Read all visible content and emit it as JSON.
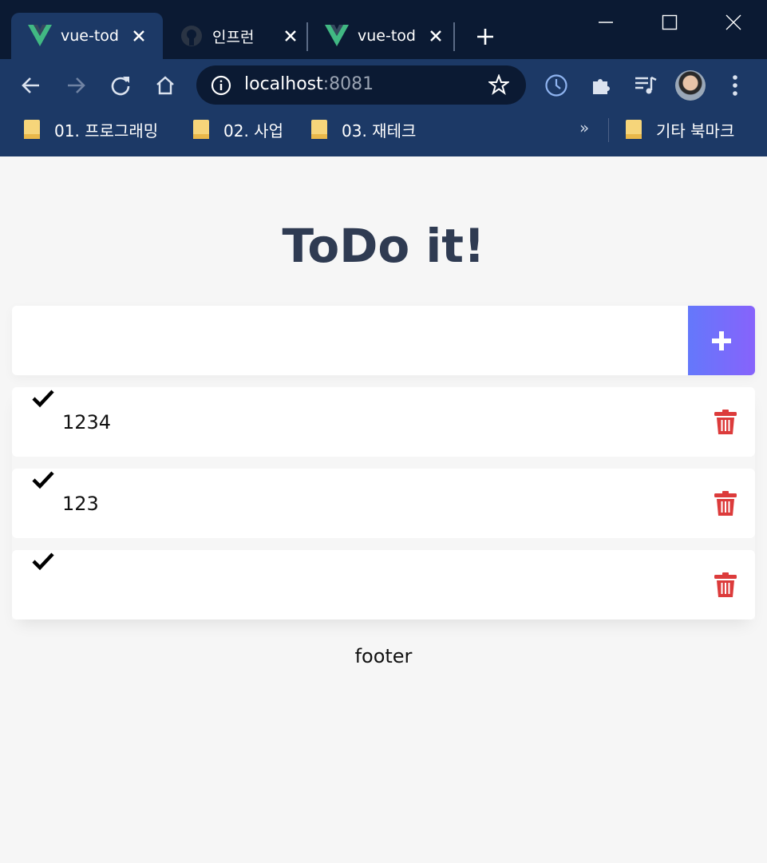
{
  "browser": {
    "tabs": [
      {
        "title": "vue-todo",
        "favicon": "vue-logo-icon",
        "active": true
      },
      {
        "title": "인프런",
        "favicon": "github-icon",
        "active": false
      },
      {
        "title": "vue-todo",
        "favicon": "vue-logo-icon",
        "active": false
      }
    ],
    "address": {
      "host": "localhost",
      "port": ":8081"
    },
    "bookmarks": [
      {
        "label": "01. 프로그래밍"
      },
      {
        "label": "02. 사업"
      },
      {
        "label": "03. 재테크"
      }
    ],
    "bookmarks_more": "»",
    "other_bookmarks": "기타 북마크",
    "colors": {
      "frame": "#0b1a33",
      "toolbar": "#1c3966"
    }
  },
  "app": {
    "title": "ToDo it!",
    "input": {
      "value": "",
      "placeholder": ""
    },
    "add_icon": "plus-icon",
    "todos": [
      {
        "text": "1234",
        "completed_icon": "check-icon",
        "delete_icon": "trash-icon"
      },
      {
        "text": "123",
        "completed_icon": "check-icon",
        "delete_icon": "trash-icon"
      },
      {
        "text": "",
        "completed_icon": "check-icon",
        "delete_icon": "trash-icon"
      }
    ],
    "footer": "footer",
    "colors": {
      "title": "#2f3b52",
      "add_gradient_start": "#6478fb",
      "add_gradient_end": "#8763fb",
      "delete": "#dc3b3b",
      "background": "#f6f6f6"
    }
  }
}
